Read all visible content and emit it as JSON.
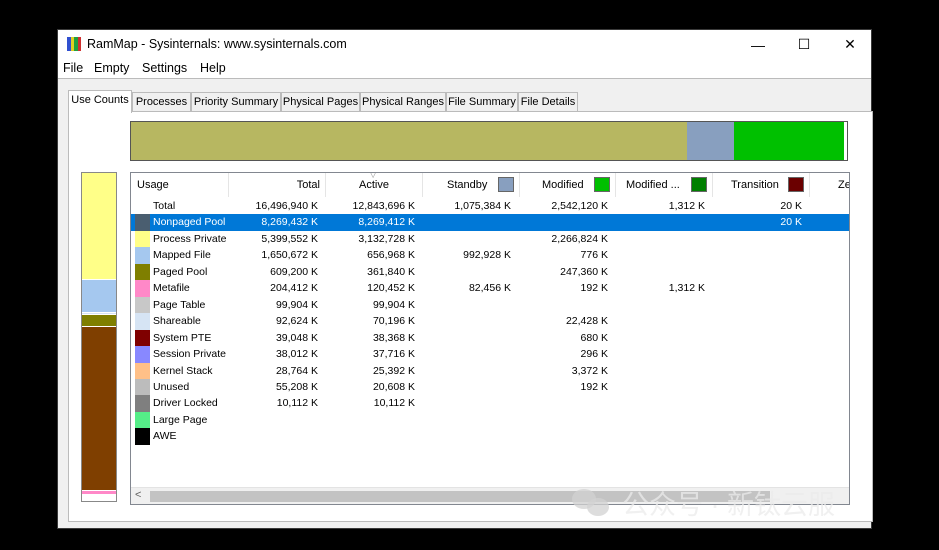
{
  "window": {
    "title": "RamMap - Sysinternals: www.sysinternals.com",
    "minimize": "—",
    "maximize": "☐",
    "close": "✕"
  },
  "menu": [
    "File",
    "Empty",
    "Settings",
    "Help"
  ],
  "tabs": [
    "Use Counts",
    "Processes",
    "Priority Summary",
    "Physical Pages",
    "Physical Ranges",
    "File Summary",
    "File Details"
  ],
  "active_tab": "Use Counts",
  "top_bar_segments": [
    {
      "category": "Active",
      "color": "#b7b761",
      "share": 0.777
    },
    {
      "category": "Standby",
      "color": "#889fbf",
      "share": 0.065
    },
    {
      "category": "Modified",
      "color": "#00c000",
      "share": 0.154
    }
  ],
  "side_bar_segments": [
    {
      "category": "Process Private",
      "color": "#ffff88",
      "share": 0.327
    },
    {
      "category": "Mapped File",
      "color": "#a5c8ef",
      "share": 0.1
    },
    {
      "category": "Shareable",
      "color": "#d6e4f4",
      "share": 0.006
    },
    {
      "category": "Paged Pool",
      "color": "#7f7f00",
      "share": 0.037
    },
    {
      "category": "Nonpaged Pool",
      "color": "#7f3f00",
      "share": 0.5
    },
    {
      "category": "Metafile",
      "color": "#ff88c8",
      "share": 0.012
    }
  ],
  "columns": [
    {
      "label": "Usage",
      "swatch": null
    },
    {
      "label": "Total",
      "swatch": null
    },
    {
      "label": "Active",
      "swatch": null
    },
    {
      "label": "Standby",
      "swatch": "#889fbf"
    },
    {
      "label": "Modified",
      "swatch": "#00c000"
    },
    {
      "label": "Modified ...",
      "swatch": "#007f00"
    },
    {
      "label": "Transition",
      "swatch": "#6b0000"
    },
    {
      "label": "Ze",
      "swatch": null
    }
  ],
  "rows": [
    {
      "usage": "Total",
      "color": null,
      "total": "16,496,940 K",
      "active": "12,843,696 K",
      "standby": "1,075,384 K",
      "modified": "2,542,120 K",
      "modified_no_write": "1,312 K",
      "transition": "20 K",
      "selected": false
    },
    {
      "usage": "Nonpaged Pool",
      "color": "#4a5e70",
      "total": "8,269,432 K",
      "active": "8,269,412 K",
      "standby": "",
      "modified": "",
      "modified_no_write": "",
      "transition": "20 K",
      "selected": true
    },
    {
      "usage": "Process Private",
      "color": "#ffff88",
      "total": "5,399,552 K",
      "active": "3,132,728 K",
      "standby": "",
      "modified": "2,266,824 K",
      "modified_no_write": "",
      "transition": "",
      "selected": false
    },
    {
      "usage": "Mapped File",
      "color": "#a5c8ef",
      "total": "1,650,672 K",
      "active": "656,968 K",
      "standby": "992,928 K",
      "modified": "776 K",
      "modified_no_write": "",
      "transition": "",
      "selected": false
    },
    {
      "usage": "Paged Pool",
      "color": "#7f7f00",
      "total": "609,200 K",
      "active": "361,840 K",
      "standby": "",
      "modified": "247,360 K",
      "modified_no_write": "",
      "transition": "",
      "selected": false
    },
    {
      "usage": "Metafile",
      "color": "#ff88c8",
      "total": "204,412 K",
      "active": "120,452 K",
      "standby": "82,456 K",
      "modified": "192 K",
      "modified_no_write": "1,312 K",
      "transition": "",
      "selected": false
    },
    {
      "usage": "Page Table",
      "color": "#c8c8c8",
      "total": "99,904 K",
      "active": "99,904 K",
      "standby": "",
      "modified": "",
      "modified_no_write": "",
      "transition": "",
      "selected": false
    },
    {
      "usage": "Shareable",
      "color": "#d6e4f4",
      "total": "92,624 K",
      "active": "70,196 K",
      "standby": "",
      "modified": "22,428 K",
      "modified_no_write": "",
      "transition": "",
      "selected": false
    },
    {
      "usage": "System PTE",
      "color": "#7f0000",
      "total": "39,048 K",
      "active": "38,368 K",
      "standby": "",
      "modified": "680 K",
      "modified_no_write": "",
      "transition": "",
      "selected": false
    },
    {
      "usage": "Session Private",
      "color": "#8888ff",
      "total": "38,012 K",
      "active": "37,716 K",
      "standby": "",
      "modified": "296 K",
      "modified_no_write": "",
      "transition": "",
      "selected": false
    },
    {
      "usage": "Kernel Stack",
      "color": "#ffc088",
      "total": "28,764 K",
      "active": "25,392 K",
      "standby": "",
      "modified": "3,372 K",
      "modified_no_write": "",
      "transition": "",
      "selected": false
    },
    {
      "usage": "Unused",
      "color": "#bcbcbc",
      "total": "55,208 K",
      "active": "20,608 K",
      "standby": "",
      "modified": "192 K",
      "modified_no_write": "",
      "transition": "",
      "selected": false
    },
    {
      "usage": "Driver Locked",
      "color": "#7f7f7f",
      "total": "10,112 K",
      "active": "10,112 K",
      "standby": "",
      "modified": "",
      "modified_no_write": "",
      "transition": "",
      "selected": false
    },
    {
      "usage": "Large Page",
      "color": "#55ee88",
      "total": "",
      "active": "",
      "standby": "",
      "modified": "",
      "modified_no_write": "",
      "transition": "",
      "selected": false
    },
    {
      "usage": "AWE",
      "color": "#000000",
      "total": "",
      "active": "",
      "standby": "",
      "modified": "",
      "modified_no_write": "",
      "transition": "",
      "selected": false
    }
  ],
  "watermark": "公众号 · 新钛云服"
}
